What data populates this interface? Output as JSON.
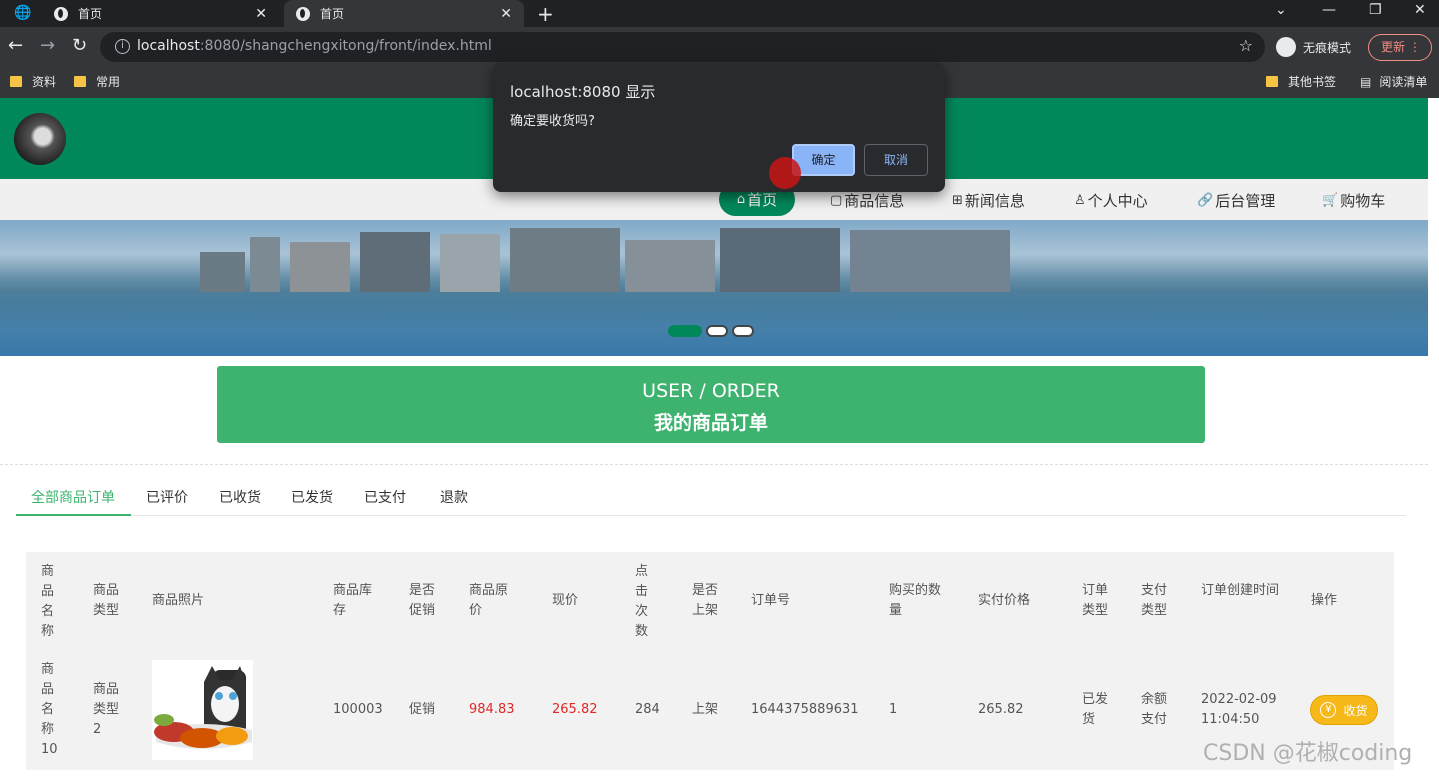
{
  "browser": {
    "tabs": [
      {
        "label": "首页"
      },
      {
        "label": "首页"
      }
    ],
    "url_host": "localhost",
    "url_path": ":8080/shangchengxitong/front/index.html",
    "incognito_label": "无痕模式",
    "update_label": "更新",
    "bookmarks": [
      "资料",
      "常用"
    ],
    "bookmarks_right": [
      "其他书签",
      "阅读清单"
    ]
  },
  "dialog": {
    "title": "localhost:8080 显示",
    "message": "确定要收货吗?",
    "ok_label": "确定",
    "cancel_label": "取消"
  },
  "nav": [
    {
      "label": "首页",
      "icon": "home-icon"
    },
    {
      "label": "商品信息",
      "icon": "document-icon"
    },
    {
      "label": "新闻信息",
      "icon": "news-icon"
    },
    {
      "label": "个人中心",
      "icon": "user-icon"
    },
    {
      "label": "后台管理",
      "icon": "link-icon"
    },
    {
      "label": "购物车",
      "icon": "cart-icon"
    }
  ],
  "hero": {
    "en": "USER / ORDER",
    "cn": "我的商品订单"
  },
  "order_tabs": [
    "全部商品订单",
    "已评价",
    "已收货",
    "已发货",
    "已支付",
    "退款"
  ],
  "table": {
    "headers": [
      "商品名称",
      "商品类型",
      "商品照片",
      "商品库存",
      "是否促销",
      "商品原价",
      "现价",
      "点击次数",
      "是否上架",
      "订单号",
      "购买的数量",
      "实付价格",
      "订单类型",
      "支付类型",
      "订单创建时间",
      "操作"
    ],
    "row": {
      "name": "商品名称10",
      "type": "商品类型2",
      "stock": "100003",
      "promo": "促销",
      "orig_price": "984.83",
      "price": "265.82",
      "clicks": "284",
      "listed": "上架",
      "order_no": "1644375889631",
      "qty": "1",
      "paid": "265.82",
      "order_type": "已发货",
      "pay_type": "余额支付",
      "created_date": "2022-02-09",
      "created_time": "11:04:50",
      "action_label": "收货"
    }
  },
  "watermark": "CSDN @花椒coding",
  "colors": {
    "brand": "#00875a",
    "hero": "#3db36f",
    "price": "#e02828",
    "action": "#f6b919"
  }
}
